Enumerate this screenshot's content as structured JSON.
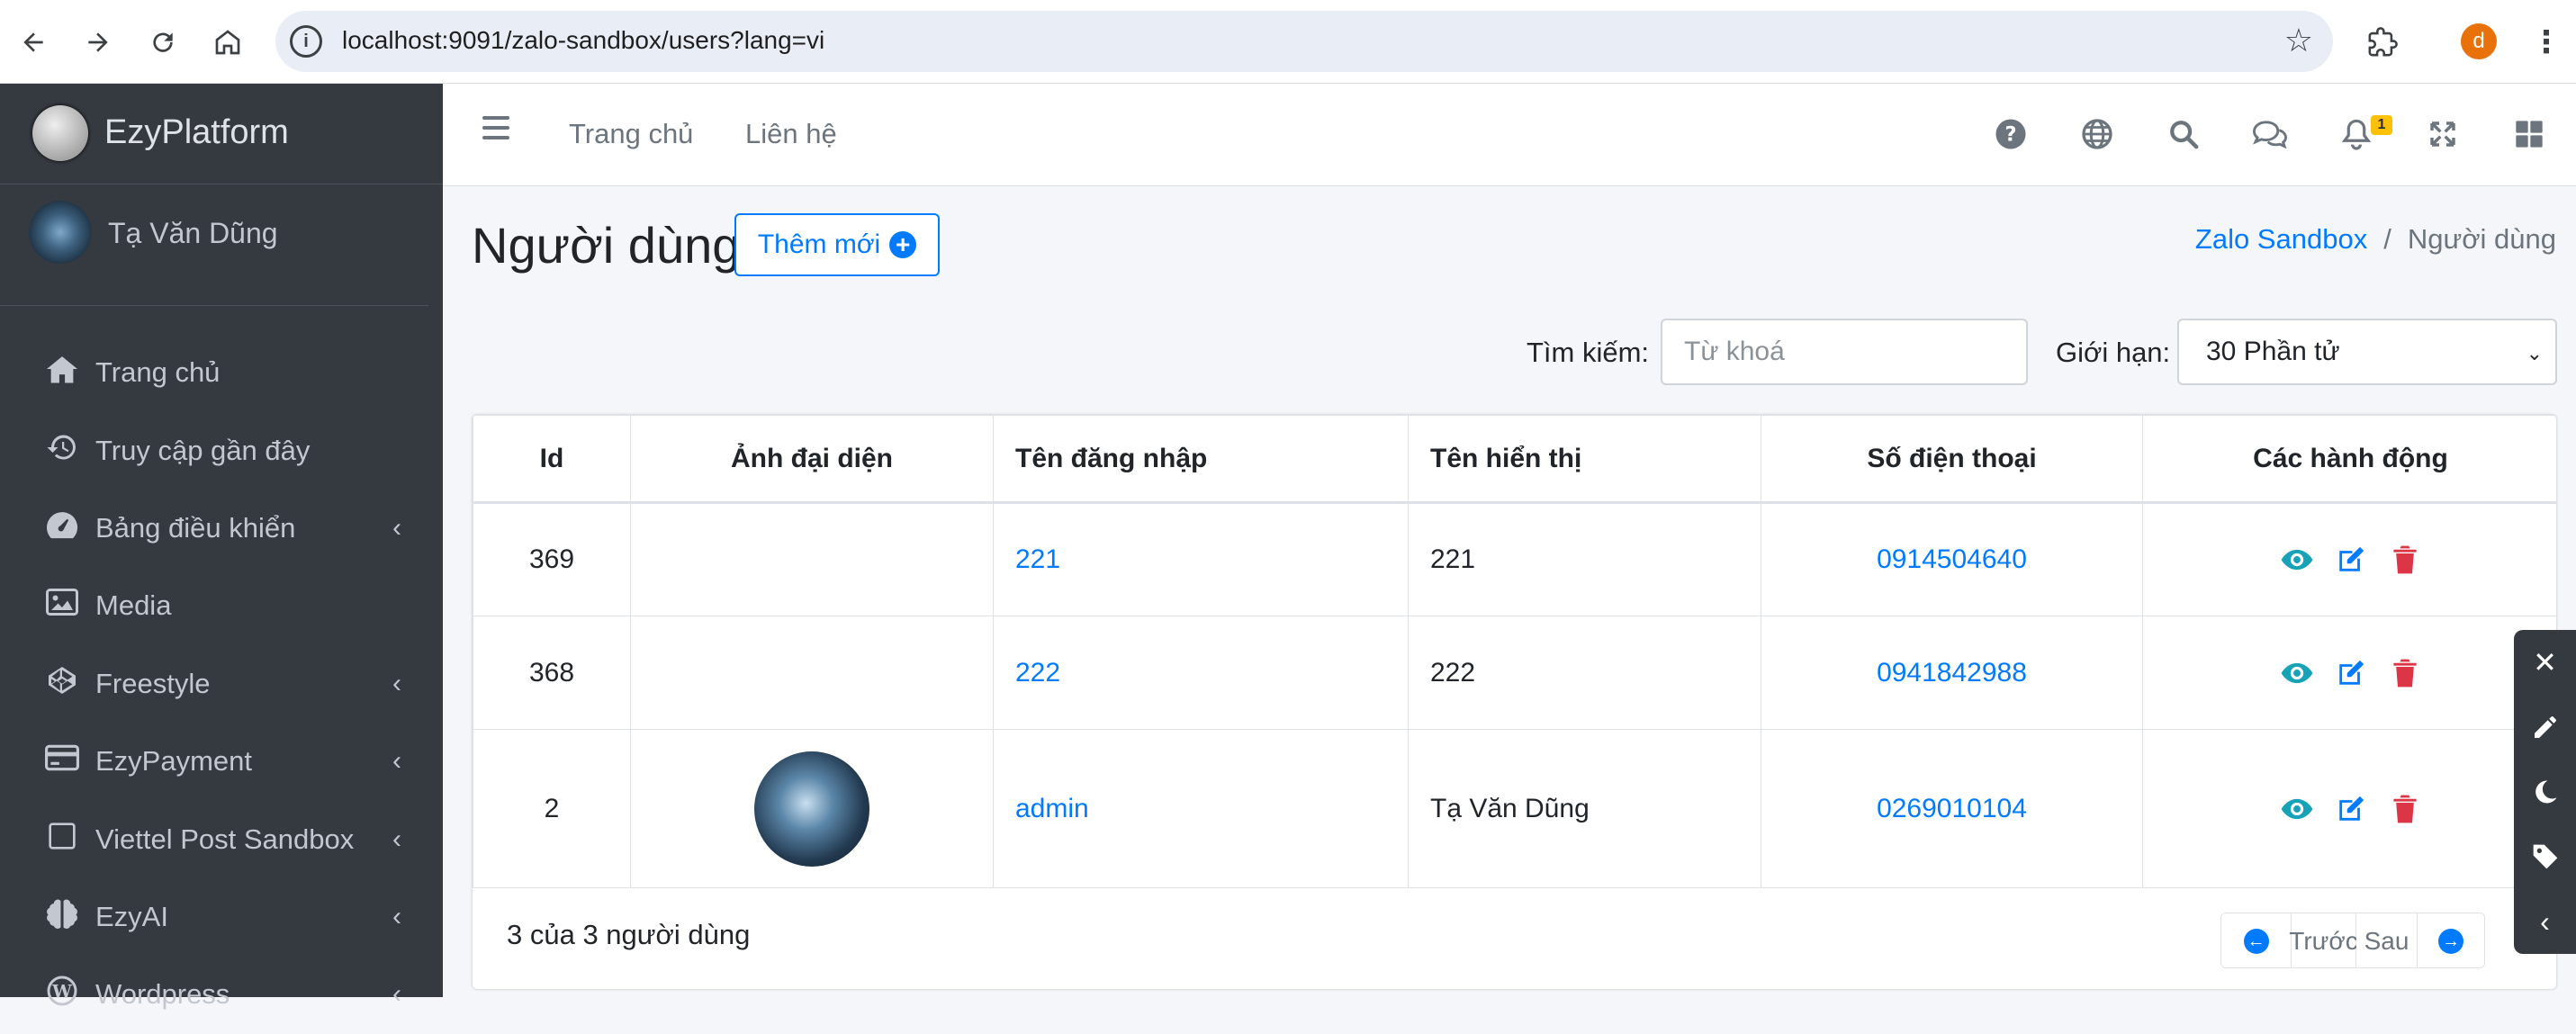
{
  "browser": {
    "url": "localhost:9091/zalo-sandbox/users?lang=vi",
    "avatar_letter": "d"
  },
  "sidebar": {
    "brand": "EzyPlatform",
    "user_name": "Tạ Văn Dũng",
    "items": [
      {
        "label": "Trang chủ",
        "icon": "home-icon",
        "has_arrow": false
      },
      {
        "label": "Truy cập gần đây",
        "icon": "history-icon",
        "has_arrow": false
      },
      {
        "label": "Bảng điều khiển",
        "icon": "dashboard-icon",
        "has_arrow": true
      },
      {
        "label": "Media",
        "icon": "image-icon",
        "has_arrow": false
      },
      {
        "label": "Freestyle",
        "icon": "codepen-icon",
        "has_arrow": true
      },
      {
        "label": "EzyPayment",
        "icon": "credit-card-icon",
        "has_arrow": true
      },
      {
        "label": "Viettel Post Sandbox",
        "icon": "square-icon",
        "has_arrow": true
      },
      {
        "label": "EzyAI",
        "icon": "brain-icon",
        "has_arrow": true
      },
      {
        "label": "Wordpress",
        "icon": "wordpress-icon",
        "has_arrow": true
      }
    ]
  },
  "topnav": {
    "links": [
      "Trang chủ",
      "Liên hệ"
    ],
    "notification_count": "1"
  },
  "page": {
    "title": "Người dùng",
    "add_button": "Thêm mới",
    "breadcrumb": {
      "parent": "Zalo Sandbox",
      "current": "Người dùng"
    }
  },
  "filters": {
    "search_label": "Tìm kiếm:",
    "search_placeholder": "Từ khoá",
    "limit_label": "Giới hạn:",
    "limit_value": "30 Phần tử"
  },
  "table": {
    "headers": [
      "Id",
      "Ảnh đại diện",
      "Tên đăng nhập",
      "Tên hiển thị",
      "Số điện thoại",
      "Các hành động"
    ],
    "rows": [
      {
        "id": "369",
        "has_avatar": false,
        "username": "221",
        "display_name": "221",
        "phone": "0914504640"
      },
      {
        "id": "368",
        "has_avatar": false,
        "username": "222",
        "display_name": "222",
        "phone": "0941842988"
      },
      {
        "id": "2",
        "has_avatar": true,
        "username": "admin",
        "display_name": "Tạ Văn Dũng",
        "phone": "0269010104"
      }
    ],
    "summary": "3 của 3 người dùng"
  },
  "pagination": {
    "prev": "Trước",
    "next": "Sau"
  },
  "colors": {
    "sidebar": "#343a40",
    "primary": "#007bff",
    "info": "#17a2b8",
    "danger": "#dc3545"
  }
}
